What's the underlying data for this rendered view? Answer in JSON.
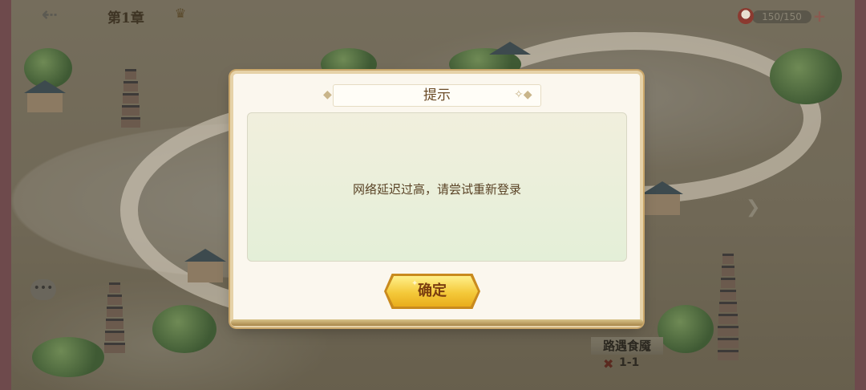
{
  "topbar": {
    "back_icon": "back-arrow-icon",
    "chapter_title": "第1章",
    "star_icon": "crown-icon",
    "stamina_value": "150/150",
    "stamina_add": "+"
  },
  "map": {
    "stage_label": "路遇食魇",
    "stage_id": "1-1",
    "chat_icon": "chat-bubble-icon",
    "next_icon": "chevron-right-icon"
  },
  "dialog": {
    "title": "提示",
    "message": "网络延迟过高，请尝试重新登录",
    "confirm_label": "确定"
  },
  "colors": {
    "dialog_bg": "#fbf7ee",
    "button_gold": "#f4c93a",
    "button_text": "#7a3d10",
    "title_text": "#6a4a26"
  }
}
